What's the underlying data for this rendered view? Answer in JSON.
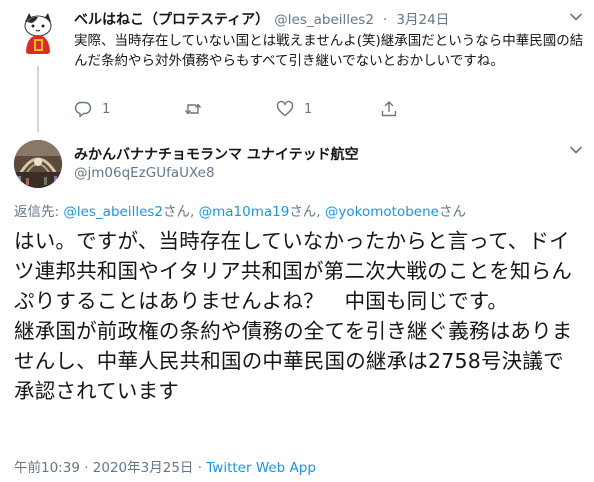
{
  "parent_tweet": {
    "display_name": "ベルはねこ（プロテスティア）",
    "handle": "@les_abeilles2",
    "separator": "·",
    "date": "3月24日",
    "text": "実際、当時存在していない国とは戦えませんよ(笑)継承国だというなら中華民國の結んだ条約やら対外債務やらもすべて引き継いでないとおかしいですね。",
    "reply_count": "1",
    "retweet_count": "",
    "like_count": "1"
  },
  "main_tweet": {
    "display_name": "みかんバナナチョモランマ ユナイテッド航空",
    "handle": "@jm06qEzGUfaUXe8",
    "reply_to": {
      "prefix": "返信先: ",
      "mentions": [
        "@les_abeilles2",
        "@ma10ma19",
        "@yokomotobene"
      ],
      "suffix_1": "さん, ",
      "suffix_2": "さん, ",
      "suffix_3": "さん"
    },
    "text": "はい。ですが、当時存在していなかったからと言って、ドイツ連邦共和国やイタリア共和国が第二次大戦のことを知らんぷりすることはありませんよね？　中国も同じです。\n継承国が前政権の条約や債務の全てを引き継ぐ義務はありませんし、中華人民共和国の中華民国の継承は2758号決議で承認されています",
    "timestamp": "午前10:39 · 2020年3月25日 · ",
    "source": "Twitter Web App"
  },
  "icons": {
    "more": "chevron-down-icon",
    "reply": "reply-icon",
    "retweet": "retweet-icon",
    "like": "heart-icon",
    "share": "share-icon"
  },
  "colors": {
    "text": "#14171a",
    "secondary": "#657786",
    "link": "#1b95e0",
    "thread_line": "#ccd6dd"
  }
}
